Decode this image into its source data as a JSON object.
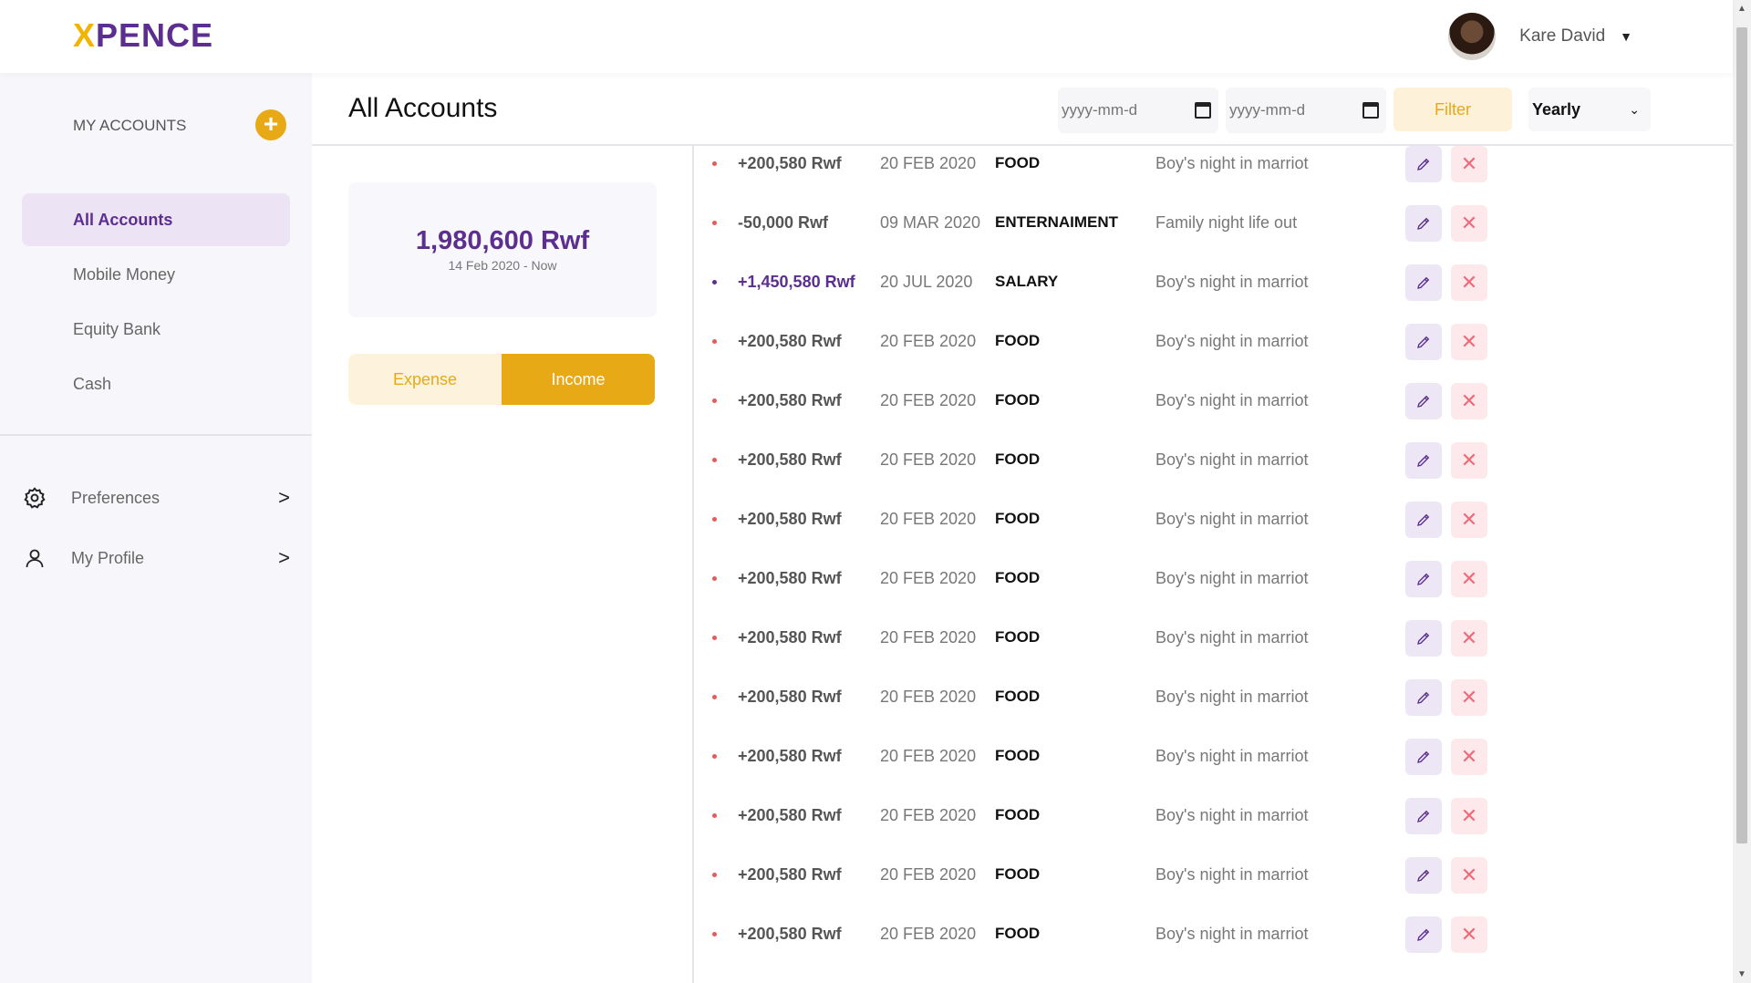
{
  "header": {
    "logo_x": "X",
    "logo_rest": "PENCE",
    "user_name": "Kare David",
    "caret": "▼"
  },
  "sidebar": {
    "section_title": "MY ACCOUNTS",
    "add_symbol": "+",
    "accounts": [
      {
        "label": "All Accounts",
        "active": true
      },
      {
        "label": "Mobile Money",
        "active": false
      },
      {
        "label": "Equity Bank",
        "active": false
      },
      {
        "label": "Cash",
        "active": false
      }
    ],
    "links": [
      {
        "label": "Preferences",
        "icon": "gear-icon"
      },
      {
        "label": "My Profile",
        "icon": "user-icon"
      }
    ],
    "chevron": ">"
  },
  "main": {
    "title": "All Accounts",
    "date_from_placeholder": "yyyy-mm-d",
    "date_to_placeholder": "yyyy-mm-d",
    "filter_label": "Filter",
    "period": "Yearly",
    "balance": {
      "amount": "1,980,600 Rwf",
      "range": "14 Feb 2020 - Now"
    },
    "toggle": {
      "expense": "Expense",
      "income": "Income"
    },
    "transactions": [
      {
        "amount": "+200,580 Rwf",
        "date": "20 FEB 2020",
        "category": "FOOD",
        "description": "Boy's night in marriot",
        "type": "expense"
      },
      {
        "amount": "-50,000 Rwf",
        "date": "09 MAR 2020",
        "category": "ENTERNAIMENT",
        "description": "Family night life out",
        "type": "expense"
      },
      {
        "amount": "+1,450,580 Rwf",
        "date": "20 JUL 2020",
        "category": "SALARY",
        "description": "Boy's night in marriot",
        "type": "income"
      },
      {
        "amount": "+200,580 Rwf",
        "date": "20 FEB 2020",
        "category": "FOOD",
        "description": "Boy's night in marriot",
        "type": "expense"
      },
      {
        "amount": "+200,580 Rwf",
        "date": "20 FEB 2020",
        "category": "FOOD",
        "description": "Boy's night in marriot",
        "type": "expense"
      },
      {
        "amount": "+200,580 Rwf",
        "date": "20 FEB 2020",
        "category": "FOOD",
        "description": "Boy's night in marriot",
        "type": "expense"
      },
      {
        "amount": "+200,580 Rwf",
        "date": "20 FEB 2020",
        "category": "FOOD",
        "description": "Boy's night in marriot",
        "type": "expense"
      },
      {
        "amount": "+200,580 Rwf",
        "date": "20 FEB 2020",
        "category": "FOOD",
        "description": "Boy's night in marriot",
        "type": "expense"
      },
      {
        "amount": "+200,580 Rwf",
        "date": "20 FEB 2020",
        "category": "FOOD",
        "description": "Boy's night in marriot",
        "type": "expense"
      },
      {
        "amount": "+200,580 Rwf",
        "date": "20 FEB 2020",
        "category": "FOOD",
        "description": "Boy's night in marriot",
        "type": "expense"
      },
      {
        "amount": "+200,580 Rwf",
        "date": "20 FEB 2020",
        "category": "FOOD",
        "description": "Boy's night in marriot",
        "type": "expense"
      },
      {
        "amount": "+200,580 Rwf",
        "date": "20 FEB 2020",
        "category": "FOOD",
        "description": "Boy's night in marriot",
        "type": "expense"
      },
      {
        "amount": "+200,580 Rwf",
        "date": "20 FEB 2020",
        "category": "FOOD",
        "description": "Boy's night in marriot",
        "type": "expense"
      },
      {
        "amount": "+200,580 Rwf",
        "date": "20 FEB 2020",
        "category": "FOOD",
        "description": "Boy's night in marriot",
        "type": "expense"
      }
    ]
  },
  "colors": {
    "brand_purple": "#5b2e8f",
    "brand_yellow": "#e8a917",
    "expense_dot": "#e55a5a"
  }
}
